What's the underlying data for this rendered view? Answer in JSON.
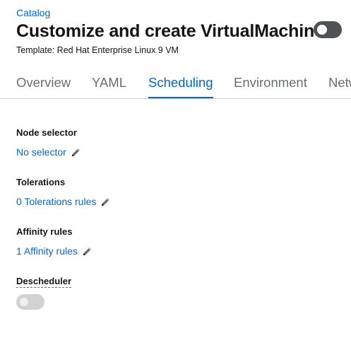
{
  "breadcrumb": {
    "label": "Catalog"
  },
  "header": {
    "title": "Customize and create VirtualMachine",
    "template_line": "Template: Red Hat Enterprise Linux 9 VM"
  },
  "tabs": [
    {
      "label": "Overview"
    },
    {
      "label": "YAML"
    },
    {
      "label": "Scheduling"
    },
    {
      "label": "Environment"
    },
    {
      "label": "Netw"
    }
  ],
  "active_tab": "Scheduling",
  "scheduling": {
    "node_selector": {
      "label": "Node selector",
      "value": "No selector"
    },
    "tolerations": {
      "label": "Tolerations",
      "value": "0 Tolerations rules"
    },
    "affinity": {
      "label": "Affinity rules",
      "value": "1 Affinity rules"
    },
    "descheduler": {
      "label": "Descheduler",
      "enabled": false
    }
  },
  "colors": {
    "link": "#0066cc",
    "text": "#151515",
    "muted_tab": "#6a6e73",
    "toggle_dark": "#4f5255",
    "toggle_disabled": "#d2d2d2"
  },
  "icons": {
    "edit": "pencil-icon"
  }
}
